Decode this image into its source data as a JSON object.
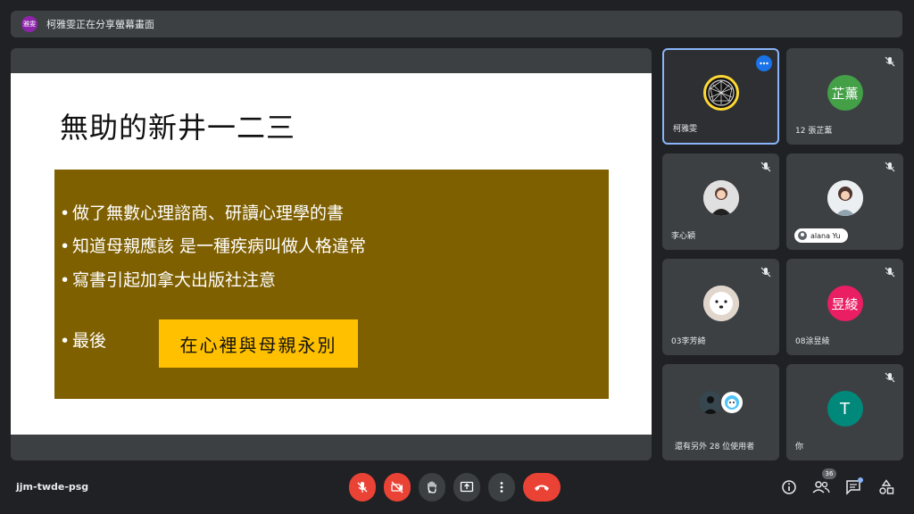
{
  "banner": {
    "avatar_text": "雅雯",
    "text": "柯雅雯正在分享螢幕畫面"
  },
  "slide": {
    "title": "無助的新井一二三",
    "bullets": [
      "做了無數心理諮商、研讀心理學的書",
      "知道母親應該 是一種疾病叫做人格違常",
      "寫書引起加拿大出版社注意",
      "最後"
    ],
    "bullet_marker": "•",
    "highlight": "在心裡與母親永別",
    "colors": {
      "box": "#7f6000",
      "highlight": "#ffc000"
    }
  },
  "participants": [
    {
      "name": "柯雅雯",
      "avatar": "photo",
      "active": true
    },
    {
      "name": "12 張芷薰",
      "avatar_text": "芷薰",
      "avatar_color": "#43a047"
    },
    {
      "name": "李心穎",
      "avatar": "photo"
    },
    {
      "name": "alana Yu",
      "avatar": "photo",
      "chip": true
    },
    {
      "name": "03李芳綺",
      "avatar": "photo"
    },
    {
      "name": "08涂昱綾",
      "avatar_text": "昱綾",
      "avatar_color": "#e91e63"
    },
    {
      "name": "還有另外 28 位使用者"
    },
    {
      "name": "你",
      "avatar_text": "T",
      "avatar_color": "#00897b"
    }
  ],
  "footer": {
    "meeting_code": "jjm-twde-psg",
    "participant_count": "36",
    "icons": [
      "mic-off-icon",
      "camera-off-icon",
      "raise-hand-icon",
      "present-screen-icon",
      "more-options-icon",
      "end-call-icon",
      "info-icon",
      "people-icon",
      "chat-icon",
      "activities-icon"
    ]
  }
}
